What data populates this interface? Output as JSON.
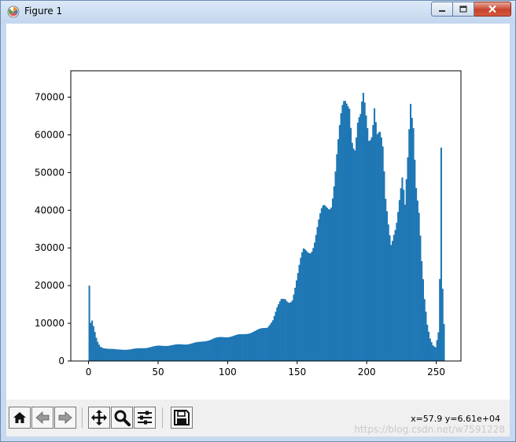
{
  "window": {
    "title": "Figure 1",
    "minimize_icon": "minimize-icon",
    "maximize_icon": "maximize-icon",
    "close_icon": "close-icon"
  },
  "toolbar": {
    "buttons": [
      "home-icon",
      "back-arrow-icon",
      "forward-arrow-icon",
      "pan-move-icon",
      "zoom-magnifier-icon",
      "configure-subplots-icon",
      "save-floppy-icon"
    ],
    "coords": "x=57.9 y=6.61e+04",
    "watermark": "https://blog.csdn.net/w7591228"
  },
  "chart_data": {
    "type": "bar",
    "title": "",
    "xlabel": "",
    "ylabel": "",
    "xlim": [
      -12.75,
      267.75
    ],
    "ylim": [
      0,
      77000
    ],
    "xticks": [
      0,
      50,
      100,
      150,
      200,
      250
    ],
    "yticks": [
      0,
      10000,
      20000,
      30000,
      40000,
      50000,
      60000,
      70000
    ],
    "grid": false,
    "color": "#1f77b4",
    "bins": 256,
    "anchors": [
      [
        0,
        20000
      ],
      [
        1,
        10000
      ],
      [
        2,
        10500
      ],
      [
        3,
        9000
      ],
      [
        4,
        7500
      ],
      [
        5,
        6000
      ],
      [
        6,
        5000
      ],
      [
        7,
        4300
      ],
      [
        8,
        3800
      ],
      [
        10,
        3500
      ],
      [
        15,
        3200
      ],
      [
        20,
        3000
      ],
      [
        30,
        3100
      ],
      [
        40,
        3500
      ],
      [
        50,
        4000
      ],
      [
        60,
        4200
      ],
      [
        70,
        4500
      ],
      [
        80,
        5000
      ],
      [
        90,
        6000
      ],
      [
        100,
        6500
      ],
      [
        110,
        7000
      ],
      [
        120,
        8000
      ],
      [
        128,
        9000
      ],
      [
        132,
        11000
      ],
      [
        135,
        14000
      ],
      [
        138,
        16000
      ],
      [
        142,
        16500
      ],
      [
        146,
        17500
      ],
      [
        150,
        22000
      ],
      [
        154,
        28000
      ],
      [
        158,
        31000
      ],
      [
        162,
        33000
      ],
      [
        166,
        36000
      ],
      [
        170,
        40000
      ],
      [
        174,
        45000
      ],
      [
        178,
        55000
      ],
      [
        182,
        62000
      ],
      [
        185,
        67000
      ],
      [
        187,
        71000
      ],
      [
        189,
        64000
      ],
      [
        191,
        60000
      ],
      [
        193,
        63000
      ],
      [
        195,
        61000
      ],
      [
        197,
        65000
      ],
      [
        199,
        62000
      ],
      [
        201,
        60000
      ],
      [
        203,
        65000
      ],
      [
        205,
        73500
      ],
      [
        207,
        62000
      ],
      [
        209,
        58000
      ],
      [
        211,
        52000
      ],
      [
        213,
        40000
      ],
      [
        215,
        36000
      ],
      [
        217,
        33000
      ],
      [
        219,
        37000
      ],
      [
        221,
        39000
      ],
      [
        223,
        42000
      ],
      [
        225,
        45000
      ],
      [
        227,
        38000
      ],
      [
        229,
        52000
      ],
      [
        231,
        71000
      ],
      [
        233,
        68000
      ],
      [
        235,
        50000
      ],
      [
        237,
        40000
      ],
      [
        239,
        25000
      ],
      [
        241,
        15000
      ],
      [
        243,
        9000
      ],
      [
        245,
        6000
      ],
      [
        247,
        4500
      ],
      [
        249,
        4000
      ],
      [
        251,
        8000
      ],
      [
        252,
        22000
      ],
      [
        253,
        55000
      ],
      [
        254,
        18000
      ],
      [
        255,
        9000
      ]
    ]
  }
}
